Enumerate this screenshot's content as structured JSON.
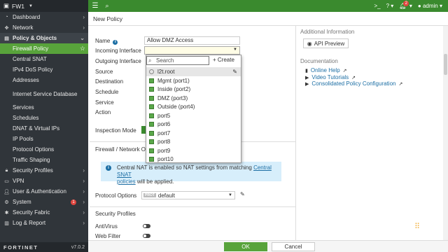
{
  "app": {
    "device": "FW1",
    "version": "v7.0.2",
    "logo": "FORTINET"
  },
  "sidebar": {
    "items": [
      {
        "label": "Dashboard"
      },
      {
        "label": "Network"
      },
      {
        "label": "Policy & Objects"
      },
      {
        "label": "Security Profiles"
      },
      {
        "label": "VPN"
      },
      {
        "label": "User & Authentication"
      },
      {
        "label": "System",
        "badge": "1"
      },
      {
        "label": "Security Fabric"
      },
      {
        "label": "Log & Report"
      }
    ],
    "policy_sub": [
      "Firewall Policy",
      "Central SNAT",
      "IPv4 DoS Policy",
      "Addresses",
      "Internet Service Database",
      "Services",
      "Schedules",
      "DNAT & Virtual IPs",
      "IP Pools",
      "Protocol Options",
      "Traffic Shaping"
    ]
  },
  "topbar": {
    "alerts": "2",
    "user": "admin"
  },
  "page": {
    "title": "New Policy"
  },
  "form": {
    "name_label": "Name",
    "name_value": "Allow DMZ Access",
    "incoming_label": "Incoming Interface",
    "outgoing_label": "Outgoing Interface",
    "source_label": "Source",
    "destination_label": "Destination",
    "schedule_label": "Schedule",
    "service_label": "Service",
    "action_label": "Action",
    "inspection_label": "Inspection Mode",
    "nat_section": "Firewall / Network Op",
    "notice_text": "Central NAT is enabled so NAT settings from matching",
    "notice_link1": "Central SNAT",
    "notice_link2": "policies",
    "notice_tail": " will be applied.",
    "protocol_label": "Protocol Options",
    "protocol_badge": "PROT",
    "protocol_value": "default",
    "security_section": "Security Profiles",
    "antivirus_label": "AntiVirus",
    "webfilter_label": "Web Filter"
  },
  "dropdown": {
    "search_placeholder": "Search",
    "create_label": "Create",
    "options": [
      "l2t.root",
      "Mgmt (port1)",
      "Inside (port2)",
      "DMZ (port3)",
      "Outside (port4)",
      "port5",
      "port6",
      "port7",
      "port8",
      "port9",
      "port10"
    ]
  },
  "right": {
    "additional_info": "Additional Information",
    "api_preview": "API Preview",
    "documentation": "Documentation",
    "docs": [
      "Online Help",
      "Video Tutorials",
      "Consolidated Policy Configuration"
    ]
  },
  "footer": {
    "ok": "OK",
    "cancel": "Cancel"
  }
}
